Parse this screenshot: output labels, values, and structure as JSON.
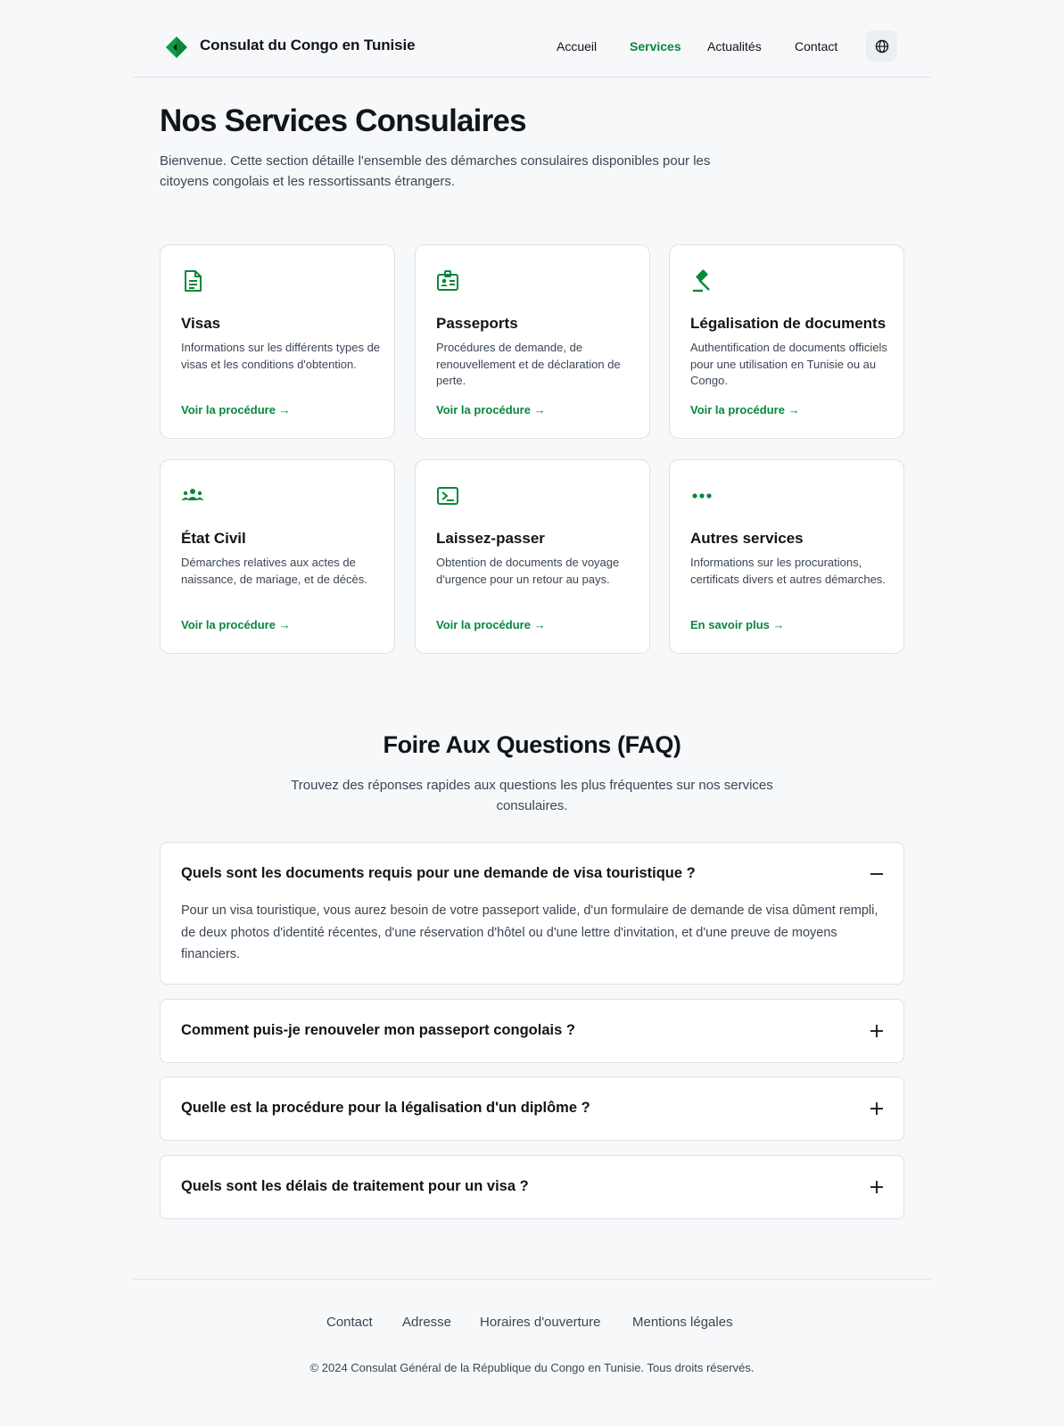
{
  "header": {
    "brand": "Consulat du Congo en Tunisie",
    "nav": [
      "Accueil",
      "Services",
      "Actualités",
      "Contact"
    ],
    "active_nav": "Services"
  },
  "hero": {
    "title": "Nos Services Consulaires",
    "lead": "Bienvenue. Cette section détaille l'ensemble des démarches consulaires disponibles pour les citoyens congolais et les ressortissants étrangers."
  },
  "services": [
    {
      "icon": "document-icon",
      "title": "Visas",
      "desc": "Informations sur les différents types de visas et les conditions d'obtention.",
      "link": "Voir la procédure →"
    },
    {
      "icon": "id-card-icon",
      "title": "Passeports",
      "desc": "Procédures de demande, de renouvellement et de déclaration de perte.",
      "link": "Voir la procédure →"
    },
    {
      "icon": "gavel-icon",
      "title": "Légalisation de documents",
      "desc": "Authentification de documents officiels pour une utilisation en Tunisie ou au Congo.",
      "link": "Voir la procédure →"
    },
    {
      "icon": "family-icon",
      "title": "État Civil",
      "desc": "Démarches relatives aux actes de naissance, de mariage, et de décès.",
      "link": "Voir la procédure →"
    },
    {
      "icon": "ticket-icon",
      "title": "Laissez-passer",
      "desc": "Obtention de documents de voyage d'urgence pour un retour au pays.",
      "link": "Voir la procédure →"
    },
    {
      "icon": "more-horizontal-icon",
      "title": "Autres services",
      "desc": "Informations sur les procurations, certificats divers et autres démarches.",
      "link": "En savoir plus →"
    }
  ],
  "faq": {
    "title": "Foire Aux Questions (FAQ)",
    "subtitle": "Trouvez des réponses rapides aux questions les plus fréquentes sur nos services consulaires.",
    "items": [
      {
        "q": "Quels sont les documents requis pour une demande de visa touristique ?",
        "a": "Pour un visa touristique, vous aurez besoin de votre passeport valide, d'un formulaire de demande de visa dûment rempli, de deux photos d'identité récentes, d'une réservation d'hôtel ou d'une lettre d'invitation, et d'une preuve de moyens financiers.",
        "open": true
      },
      {
        "q": "Comment puis-je renouveler mon passeport congolais ?",
        "open": false
      },
      {
        "q": "Quelle est la procédure pour la légalisation d'un diplôme ?",
        "open": false
      },
      {
        "q": "Quels sont les délais de traitement pour un visa ?",
        "open": false
      }
    ]
  },
  "footer": {
    "links": [
      "Contact",
      "Adresse",
      "Horaires d'ouverture",
      "Mentions légales"
    ],
    "copyright": "© 2024 Consulat Général de la République du Congo en Tunisie. Tous droits réservés."
  },
  "colors": {
    "accent": "#07883b",
    "background": "#f6f8fa",
    "text": "#111418",
    "muted": "#3b4654"
  }
}
